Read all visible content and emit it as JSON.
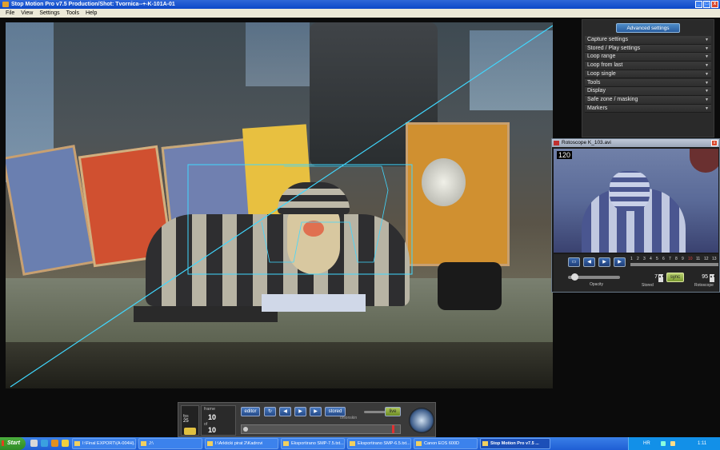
{
  "window": {
    "title": "Stop Motion Pro v7.5   Production/Shot: Tvornica--+-K-101A-01"
  },
  "menu": [
    "File",
    "View",
    "Settings",
    "Tools",
    "Help"
  ],
  "advanced": {
    "button": "Advanced settings",
    "items": [
      "Capture settings",
      "Stored / Play settings",
      "Loop range",
      "Loop from last",
      "Loop single",
      "Tools",
      "Display",
      "Safe zone / masking",
      "Markers"
    ]
  },
  "roto": {
    "title": "Rotoscope  K_103.avi",
    "frame": "120",
    "ticks": [
      "1",
      "2",
      "3",
      "4",
      "5",
      "6",
      "7",
      "8",
      "9",
      "10",
      "11",
      "12",
      "13"
    ],
    "opacity_label": "Opacity",
    "stored_value": "7",
    "stored_label": "Stored",
    "sync_label": "sync",
    "rotoscope_value": "95",
    "rotoscope_label": "Rotoscope"
  },
  "controls": {
    "fps_label": "fps",
    "fps_value": "25",
    "frame_label": "frame",
    "frame_value": "10",
    "of_label": "of",
    "total_value": "10",
    "editor_label": "editor",
    "stored_label": "stored",
    "onion_label": "onionskin",
    "live_label": "live"
  },
  "taskbar": {
    "start": "Start",
    "tasks": [
      "I:\\Final EXPORT\\(A-004H)...",
      "J:\\",
      "I:\\Arkticki pirat 2\\Kadrovi",
      "Eksportirano SMP-7.5.txt...",
      "Eksportirano SMP-6.5.txt...",
      "Canon EOS 600D",
      "Stop Motion Pro v7.5 ..."
    ],
    "lang": "HR",
    "time": "1:11"
  }
}
